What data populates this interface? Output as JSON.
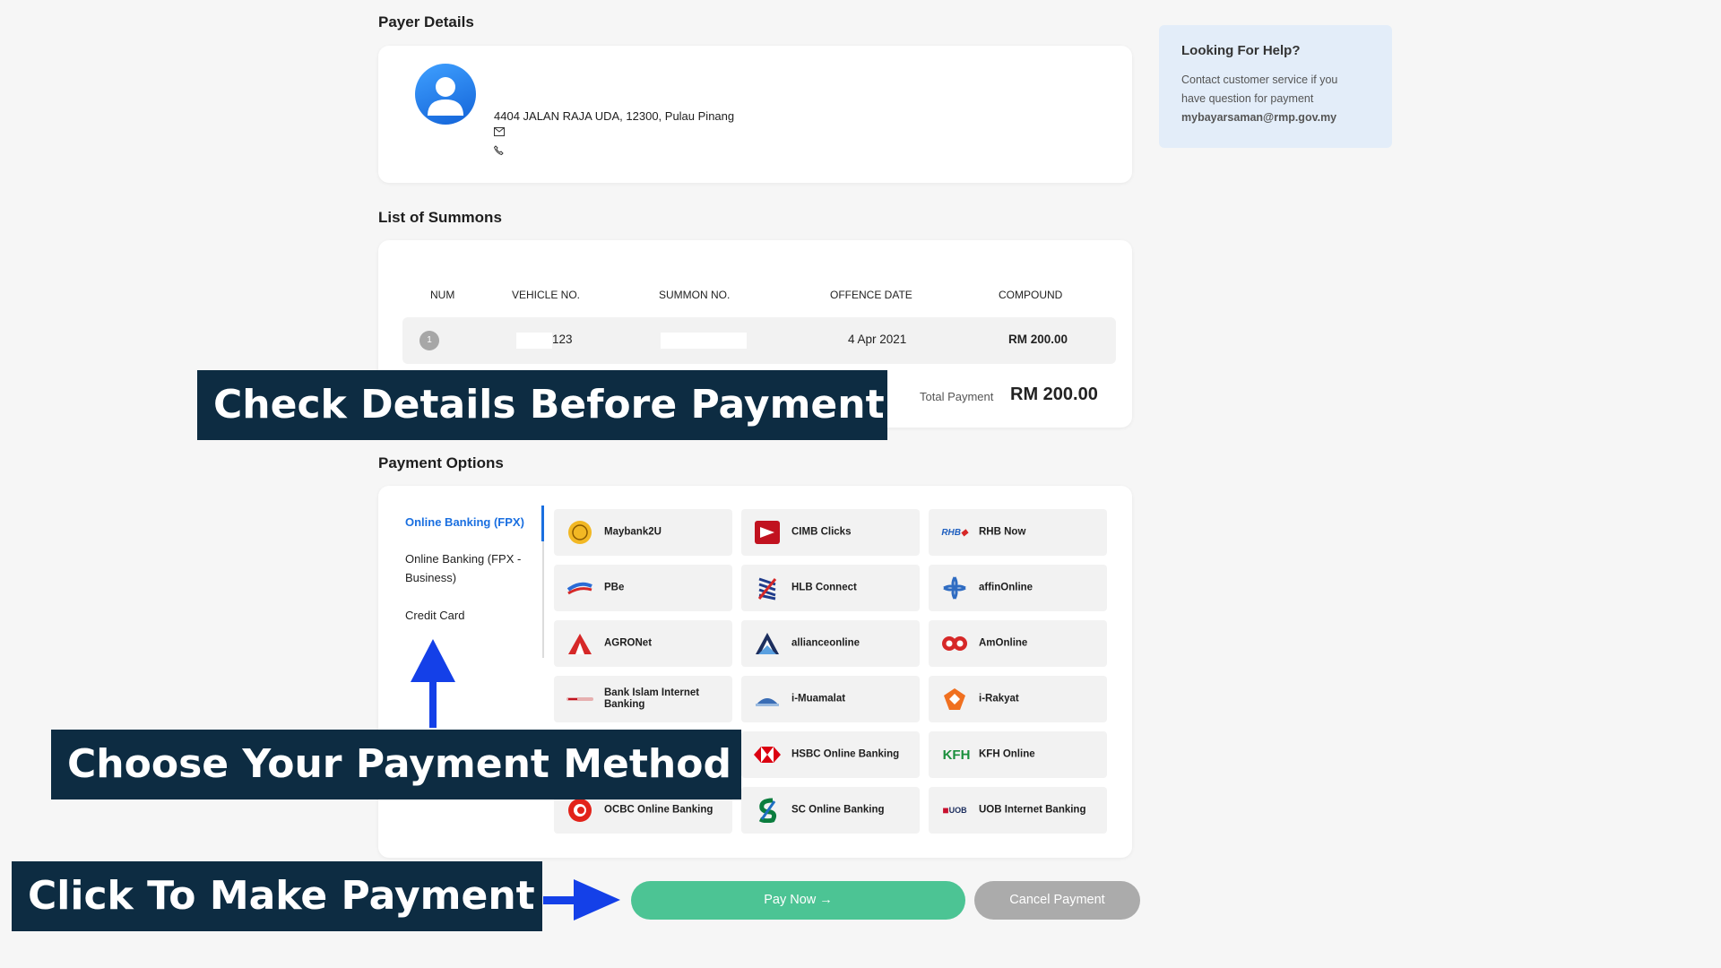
{
  "payer": {
    "section_title": "Payer Details",
    "address": "4404 JALAN RAJA UDA, 12300, Pulau Pinang",
    "icons": [
      "user-avatar-icon",
      "mail-icon",
      "phone-icon"
    ]
  },
  "help": {
    "title": "Looking For Help?",
    "text_line1": "Contact customer service if you",
    "text_line2": "have question for payment",
    "email": "mybayarsaman@rmp.gov.my"
  },
  "summons": {
    "section_title": "List of Summons",
    "columns": [
      "NUM",
      "VEHICLE NO.",
      "SUMMON NO.",
      "OFFENCE DATE",
      "COMPOUND"
    ],
    "rows": [
      {
        "num": "1",
        "vehicle_no": "123",
        "summon_no": "",
        "offence_date": "4 Apr 2021",
        "compound": "RM 200.00"
      }
    ],
    "total_label": "Total Payment",
    "total_value": "RM 200.00"
  },
  "payment": {
    "section_title": "Payment Options",
    "tabs": [
      "Online Banking (FPX)",
      "Online Banking (FPX - Business)",
      "Credit Card"
    ],
    "active_tab": 0,
    "banks": [
      {
        "name": "Maybank2U",
        "icon": "maybank-logo",
        "color": "#f2b824"
      },
      {
        "name": "CIMB Clicks",
        "icon": "cimb-logo",
        "color": "#c1121f"
      },
      {
        "name": "RHB Now",
        "icon": "rhb-logo",
        "color": "#1f5fbf"
      },
      {
        "name": "PBe",
        "icon": "publicbank-logo",
        "color": "#2b6cd6"
      },
      {
        "name": "HLB Connect",
        "icon": "hlb-logo",
        "color": "#1f3b8a"
      },
      {
        "name": "affinOnline",
        "icon": "affin-logo",
        "color": "#2f6cc2"
      },
      {
        "name": "AGRONet",
        "icon": "agro-logo",
        "color": "#d62828"
      },
      {
        "name": "allianceonline",
        "icon": "alliance-logo",
        "color": "#1c2e5e"
      },
      {
        "name": "AmOnline",
        "icon": "ambank-logo",
        "color": "#d62828"
      },
      {
        "name": "Bank Islam Internet Banking",
        "icon": "bankislam-logo",
        "color": "#c1121f"
      },
      {
        "name": "i-Muamalat",
        "icon": "muamalat-logo",
        "color": "#3a6db5"
      },
      {
        "name": "i-Rakyat",
        "icon": "rakyat-logo",
        "color": "#f07020"
      },
      {
        "name": "HSBC Online Banking",
        "icon": "hsbc-logo",
        "color": "#db0011"
      },
      {
        "name": "KFH Online",
        "icon": "kfh-logo",
        "color": "#1a8f3c"
      },
      {
        "name": "OCBC Online Banking",
        "icon": "ocbc-logo",
        "color": "#e2231a"
      },
      {
        "name": "SC Online Banking",
        "icon": "sc-logo",
        "color": "#0b7d3e"
      },
      {
        "name": "UOB Internet Banking",
        "icon": "uob-logo",
        "color": "#c8102e"
      }
    ]
  },
  "buttons": {
    "pay_now": "Pay Now →",
    "cancel": "Cancel Payment"
  },
  "callouts": {
    "check_details": "Check Details Before Payment",
    "choose_method": "Choose Your Payment Method",
    "click_pay": "Click To Make Payment"
  },
  "colors": {
    "accent_blue": "#1a6fe0",
    "pay_green": "#4cc494",
    "cancel_grey": "#ababab",
    "callout_bg": "#0d2c42",
    "arrow_blue": "#1440e8"
  }
}
